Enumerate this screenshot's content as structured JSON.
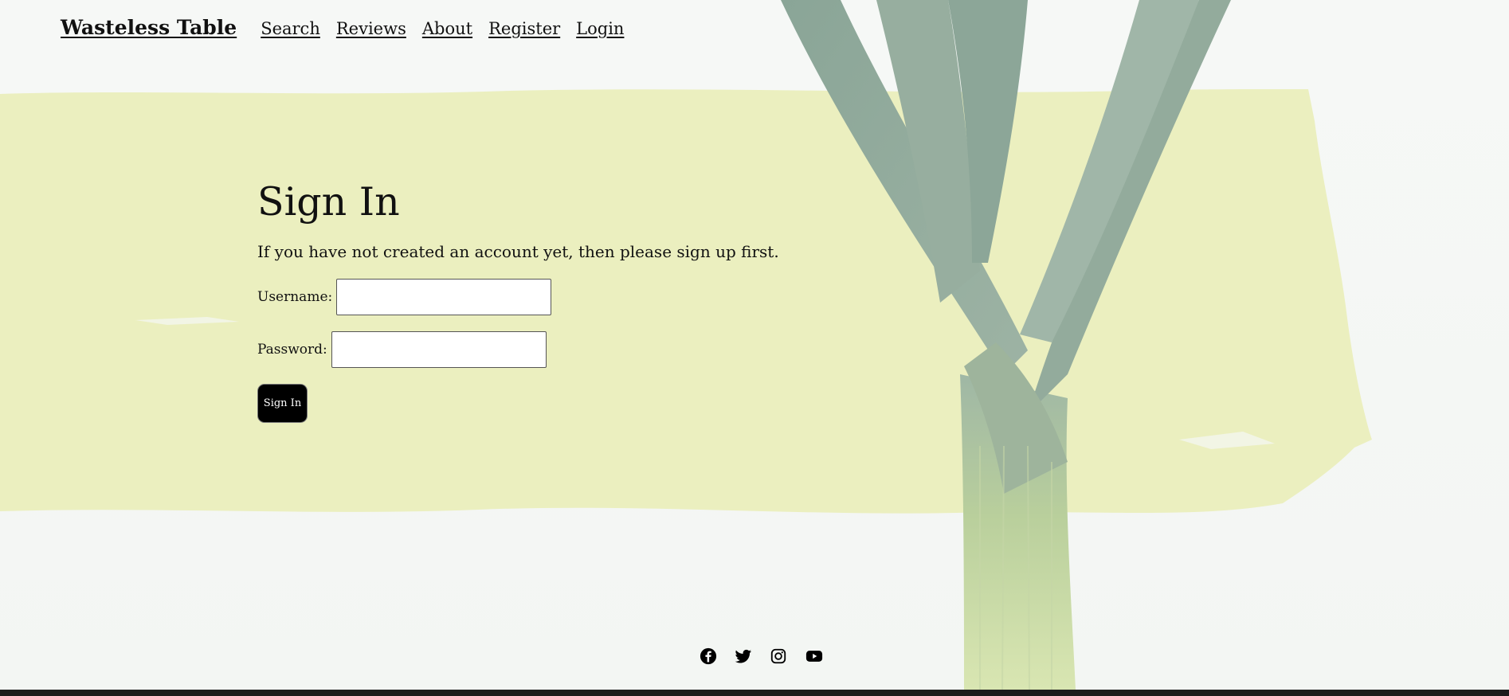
{
  "header": {
    "brand": "Wasteless Table",
    "nav": [
      "Search",
      "Reviews",
      "About",
      "Register",
      "Login"
    ]
  },
  "main": {
    "title": "Sign In",
    "subtitle": "If you have not created an account yet, then please sign up first.",
    "username_label": "Username:",
    "username_value": "",
    "password_label": "Password:",
    "password_value": "",
    "submit_label": "Sign In"
  },
  "social": [
    "facebook-icon",
    "twitter-icon",
    "instagram-icon",
    "youtube-icon"
  ],
  "colors": {
    "background": "#f4f7f4",
    "brush": "#ebefbf",
    "leek_green": "#8fa89a",
    "leek_stem": "#cbdc9a",
    "button": "#000000"
  }
}
